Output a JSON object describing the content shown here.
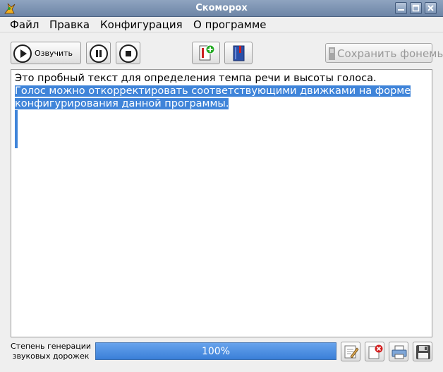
{
  "window": {
    "title": "Скоморох",
    "controls": [
      "minimize-icon",
      "maximize-icon",
      "close-icon"
    ]
  },
  "menu": [
    "Файл",
    "Правка",
    "Конфигурация",
    "О программе"
  ],
  "toolbar": {
    "say_label": "Озвучить",
    "save_label": "Сохранить фонемы",
    "icons": [
      "play-icon",
      "pause-icon",
      "stop-icon",
      "add-page-icon",
      "book-icon",
      "save-phonemes-icon"
    ]
  },
  "editor": {
    "lines": [
      "Это пробный текст для определения темпа речи и высоты голоса.",
      "Голос можно откорректировать соответствующими движками на форме",
      "конфигурирования данной программы."
    ],
    "selected_from_line": 1
  },
  "status": {
    "label_line1": "Степень генерации",
    "label_line2": "звуковых дорожек",
    "progress_text": "100%",
    "progress_value": 100
  },
  "colors": {
    "titlebar": "#7b91b1",
    "selection": "#3f84d9",
    "progress": "#4a8de0"
  }
}
